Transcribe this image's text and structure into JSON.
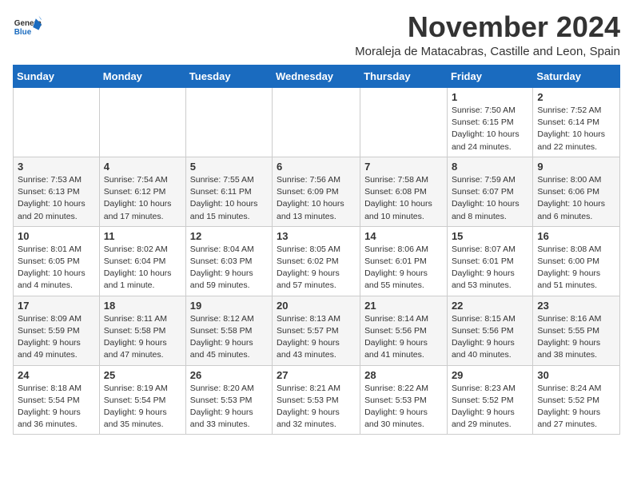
{
  "app": {
    "name": "GeneralBlue",
    "logo_text_1": "General",
    "logo_text_2": "Blue"
  },
  "calendar": {
    "month_year": "November 2024",
    "location": "Moraleja de Matacabras, Castille and Leon, Spain",
    "days_of_week": [
      "Sunday",
      "Monday",
      "Tuesday",
      "Wednesday",
      "Thursday",
      "Friday",
      "Saturday"
    ],
    "weeks": [
      [
        {
          "day": "",
          "info": ""
        },
        {
          "day": "",
          "info": ""
        },
        {
          "day": "",
          "info": ""
        },
        {
          "day": "",
          "info": ""
        },
        {
          "day": "",
          "info": ""
        },
        {
          "day": "1",
          "info": "Sunrise: 7:50 AM\nSunset: 6:15 PM\nDaylight: 10 hours and 24 minutes."
        },
        {
          "day": "2",
          "info": "Sunrise: 7:52 AM\nSunset: 6:14 PM\nDaylight: 10 hours and 22 minutes."
        }
      ],
      [
        {
          "day": "3",
          "info": "Sunrise: 7:53 AM\nSunset: 6:13 PM\nDaylight: 10 hours and 20 minutes."
        },
        {
          "day": "4",
          "info": "Sunrise: 7:54 AM\nSunset: 6:12 PM\nDaylight: 10 hours and 17 minutes."
        },
        {
          "day": "5",
          "info": "Sunrise: 7:55 AM\nSunset: 6:11 PM\nDaylight: 10 hours and 15 minutes."
        },
        {
          "day": "6",
          "info": "Sunrise: 7:56 AM\nSunset: 6:09 PM\nDaylight: 10 hours and 13 minutes."
        },
        {
          "day": "7",
          "info": "Sunrise: 7:58 AM\nSunset: 6:08 PM\nDaylight: 10 hours and 10 minutes."
        },
        {
          "day": "8",
          "info": "Sunrise: 7:59 AM\nSunset: 6:07 PM\nDaylight: 10 hours and 8 minutes."
        },
        {
          "day": "9",
          "info": "Sunrise: 8:00 AM\nSunset: 6:06 PM\nDaylight: 10 hours and 6 minutes."
        }
      ],
      [
        {
          "day": "10",
          "info": "Sunrise: 8:01 AM\nSunset: 6:05 PM\nDaylight: 10 hours and 4 minutes."
        },
        {
          "day": "11",
          "info": "Sunrise: 8:02 AM\nSunset: 6:04 PM\nDaylight: 10 hours and 1 minute."
        },
        {
          "day": "12",
          "info": "Sunrise: 8:04 AM\nSunset: 6:03 PM\nDaylight: 9 hours and 59 minutes."
        },
        {
          "day": "13",
          "info": "Sunrise: 8:05 AM\nSunset: 6:02 PM\nDaylight: 9 hours and 57 minutes."
        },
        {
          "day": "14",
          "info": "Sunrise: 8:06 AM\nSunset: 6:01 PM\nDaylight: 9 hours and 55 minutes."
        },
        {
          "day": "15",
          "info": "Sunrise: 8:07 AM\nSunset: 6:01 PM\nDaylight: 9 hours and 53 minutes."
        },
        {
          "day": "16",
          "info": "Sunrise: 8:08 AM\nSunset: 6:00 PM\nDaylight: 9 hours and 51 minutes."
        }
      ],
      [
        {
          "day": "17",
          "info": "Sunrise: 8:09 AM\nSunset: 5:59 PM\nDaylight: 9 hours and 49 minutes."
        },
        {
          "day": "18",
          "info": "Sunrise: 8:11 AM\nSunset: 5:58 PM\nDaylight: 9 hours and 47 minutes."
        },
        {
          "day": "19",
          "info": "Sunrise: 8:12 AM\nSunset: 5:58 PM\nDaylight: 9 hours and 45 minutes."
        },
        {
          "day": "20",
          "info": "Sunrise: 8:13 AM\nSunset: 5:57 PM\nDaylight: 9 hours and 43 minutes."
        },
        {
          "day": "21",
          "info": "Sunrise: 8:14 AM\nSunset: 5:56 PM\nDaylight: 9 hours and 41 minutes."
        },
        {
          "day": "22",
          "info": "Sunrise: 8:15 AM\nSunset: 5:56 PM\nDaylight: 9 hours and 40 minutes."
        },
        {
          "day": "23",
          "info": "Sunrise: 8:16 AM\nSunset: 5:55 PM\nDaylight: 9 hours and 38 minutes."
        }
      ],
      [
        {
          "day": "24",
          "info": "Sunrise: 8:18 AM\nSunset: 5:54 PM\nDaylight: 9 hours and 36 minutes."
        },
        {
          "day": "25",
          "info": "Sunrise: 8:19 AM\nSunset: 5:54 PM\nDaylight: 9 hours and 35 minutes."
        },
        {
          "day": "26",
          "info": "Sunrise: 8:20 AM\nSunset: 5:53 PM\nDaylight: 9 hours and 33 minutes."
        },
        {
          "day": "27",
          "info": "Sunrise: 8:21 AM\nSunset: 5:53 PM\nDaylight: 9 hours and 32 minutes."
        },
        {
          "day": "28",
          "info": "Sunrise: 8:22 AM\nSunset: 5:53 PM\nDaylight: 9 hours and 30 minutes."
        },
        {
          "day": "29",
          "info": "Sunrise: 8:23 AM\nSunset: 5:52 PM\nDaylight: 9 hours and 29 minutes."
        },
        {
          "day": "30",
          "info": "Sunrise: 8:24 AM\nSunset: 5:52 PM\nDaylight: 9 hours and 27 minutes."
        }
      ]
    ]
  }
}
